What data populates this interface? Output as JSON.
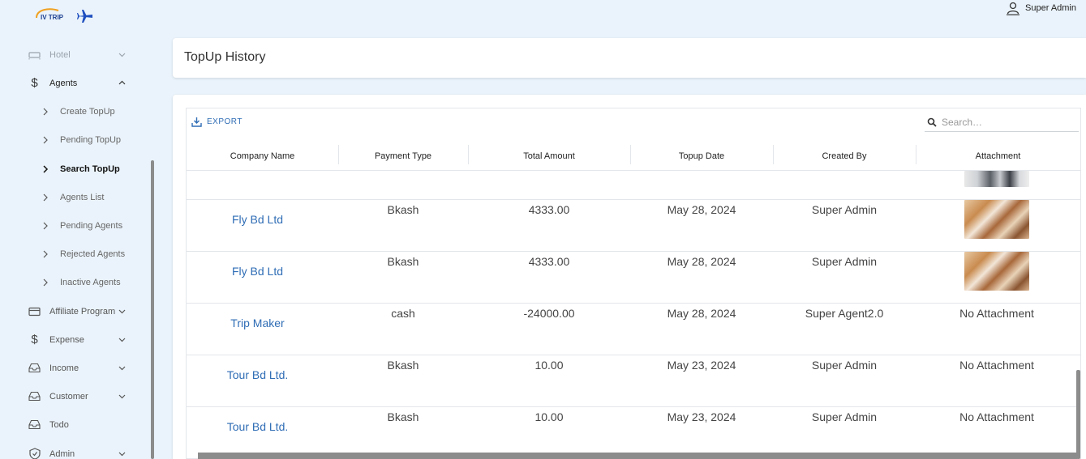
{
  "app": {
    "logo_text": "IV TRIP"
  },
  "user": {
    "name": "Super Admin"
  },
  "sidebar": {
    "items": [
      {
        "label": "Hotel",
        "icon": "bed-icon"
      },
      {
        "label": "Agents",
        "icon": "dollar-icon"
      },
      {
        "label": "Affiliate Program",
        "icon": "card-icon"
      },
      {
        "label": "Expense",
        "icon": "dollar-icon"
      },
      {
        "label": "Income",
        "icon": "inbox-icon"
      },
      {
        "label": "Customer",
        "icon": "inbox-icon"
      },
      {
        "label": "Todo",
        "icon": "inbox-icon"
      },
      {
        "label": "Admin",
        "icon": "shield-icon"
      }
    ],
    "agents_sub": [
      "Create TopUp",
      "Pending TopUp",
      "Search TopUp",
      "Agents List",
      "Pending Agents",
      "Rejected Agents",
      "Inactive Agents"
    ]
  },
  "page": {
    "title": "TopUp History"
  },
  "toolbar": {
    "export_label": "EXPORT",
    "search_placeholder": "Search…"
  },
  "table": {
    "columns": [
      "Company Name",
      "Payment Type",
      "Total Amount",
      "Topup Date",
      "Created By",
      "Attachment"
    ],
    "rows": [
      {
        "company": "Fly Bd Ltd",
        "payment": "Bkash",
        "amount": "4333.00",
        "date": "May 28, 2024",
        "created_by": "Super Admin",
        "attachment": ""
      },
      {
        "company": "Fly Bd Ltd",
        "payment": "Bkash",
        "amount": "4333.00",
        "date": "May 28, 2024",
        "created_by": "Super Admin",
        "attachment": ""
      },
      {
        "company": "Trip Maker",
        "payment": "cash",
        "amount": "-24000.00",
        "date": "May 28, 2024",
        "created_by": "Super Agent2.0",
        "attachment": "No Attachment"
      },
      {
        "company": "Tour Bd Ltd.",
        "payment": "Bkash",
        "amount": "10.00",
        "date": "May 23, 2024",
        "created_by": "Super Admin",
        "attachment": "No Attachment"
      },
      {
        "company": "Tour Bd Ltd.",
        "payment": "Bkash",
        "amount": "10.00",
        "date": "May 23, 2024",
        "created_by": "Super Admin",
        "attachment": "No Attachment"
      }
    ]
  },
  "colors": {
    "link": "#2f6db5",
    "background": "#eaf3fb"
  }
}
